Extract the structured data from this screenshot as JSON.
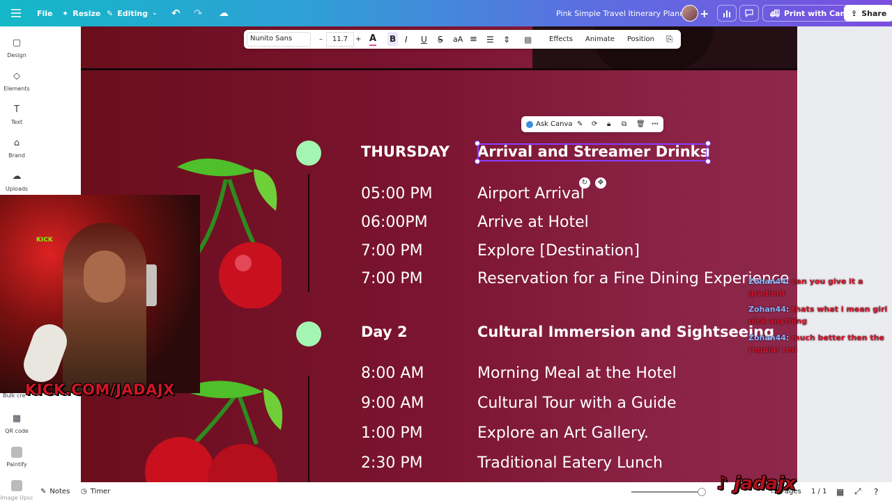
{
  "topbar": {
    "file": "File",
    "resize": "Resize",
    "editing": "Editing",
    "doc_title": "Pink Simple Travel Itinerary Planner",
    "print": "Print with Canva",
    "share": "Share"
  },
  "rail": {
    "items": [
      {
        "label": "Design",
        "icon": "design-icon"
      },
      {
        "label": "Elements",
        "icon": "elements-icon"
      },
      {
        "label": "Text",
        "icon": "text-icon"
      },
      {
        "label": "Brand",
        "icon": "brand-icon"
      },
      {
        "label": "Uploads",
        "icon": "uploads-icon"
      },
      {
        "label": "Bulk cre",
        "icon": "bulk-create-icon"
      },
      {
        "label": "QR code",
        "icon": "qr-code-icon"
      },
      {
        "label": "Paintify",
        "icon": "paintify-icon"
      },
      {
        "label": "Image Upsc",
        "icon": "image-upscaler-icon"
      }
    ]
  },
  "text_toolbar": {
    "font": "Nunito Sans",
    "minus": "–",
    "size": "11.7",
    "plus": "+",
    "effects": "Effects",
    "animate": "Animate",
    "position": "Position"
  },
  "context_toolbar": {
    "ask_canva": "Ask Canva"
  },
  "itinerary": {
    "day1": {
      "day": "THURSDAY",
      "title": "Arrival and Streamer Drinks",
      "rows": [
        {
          "time": "05:00 PM",
          "activity": "Airport Arrival"
        },
        {
          "time": "06:00PM",
          "activity": "Arrive at Hotel"
        },
        {
          "time": "7:00 PM",
          "activity": "Explore [Destination]"
        },
        {
          "time": "7:00 PM",
          "activity": "Reservation for a Fine Dining Experience"
        }
      ]
    },
    "day2": {
      "day": "Day 2",
      "title": "Cultural Immersion and Sightseeing",
      "rows": [
        {
          "time": "8:00 AM",
          "activity": "Morning Meal at the Hotel"
        },
        {
          "time": "9:00 AM",
          "activity": "Cultural Tour with a Guide"
        },
        {
          "time": "1:00 PM",
          "activity": "Explore an Art Gallery."
        },
        {
          "time": "2:30 PM",
          "activity": "Traditional Eatery Lunch"
        }
      ]
    }
  },
  "webcam": {
    "badge": "KICK",
    "url": "KICK.COM/JADAJX"
  },
  "chat": [
    {
      "user": "Zohan44:",
      "message": "can you give it a gradient"
    },
    {
      "user": "Zohan44:",
      "message": "thats what i mean girl pick anything"
    },
    {
      "user": "Zohan44:",
      "message": "much better then the regular red"
    }
  ],
  "bottombar": {
    "notes": "Notes",
    "timer": "Timer",
    "pages": "Pages",
    "page_count": "1 / 1"
  },
  "watermark": "jadajx",
  "colors": {
    "accent_purple": "#8b3dff",
    "dot_green": "#a5f5b2",
    "canvas_red": "#6a0e1c"
  }
}
